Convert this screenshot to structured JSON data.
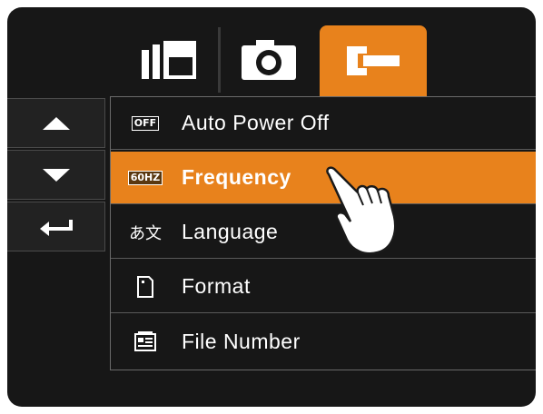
{
  "tabs": {
    "video": "video-mode-icon",
    "photo": "camera-icon",
    "setup": "wrench-icon",
    "active": "setup"
  },
  "nav": {
    "up": "triangle-up-icon",
    "down": "triangle-down-icon",
    "enter": "return-arrow-icon"
  },
  "menu": {
    "items": [
      {
        "icon_text": "OFF",
        "icon": "auto-power-off-icon",
        "label": "Auto Power Off"
      },
      {
        "icon_text": "60HZ",
        "icon": "frequency-icon",
        "label": "Frequency",
        "selected": true
      },
      {
        "icon_text": "あ文",
        "icon": "language-icon",
        "label": "Language"
      },
      {
        "icon_text": "",
        "icon": "format-card-icon",
        "label": "Format"
      },
      {
        "icon_text": "",
        "icon": "file-number-icon",
        "label": "File Number"
      }
    ]
  },
  "colors": {
    "accent": "#e8821c",
    "background": "#171717"
  },
  "pointer": "hand-cursor-icon"
}
